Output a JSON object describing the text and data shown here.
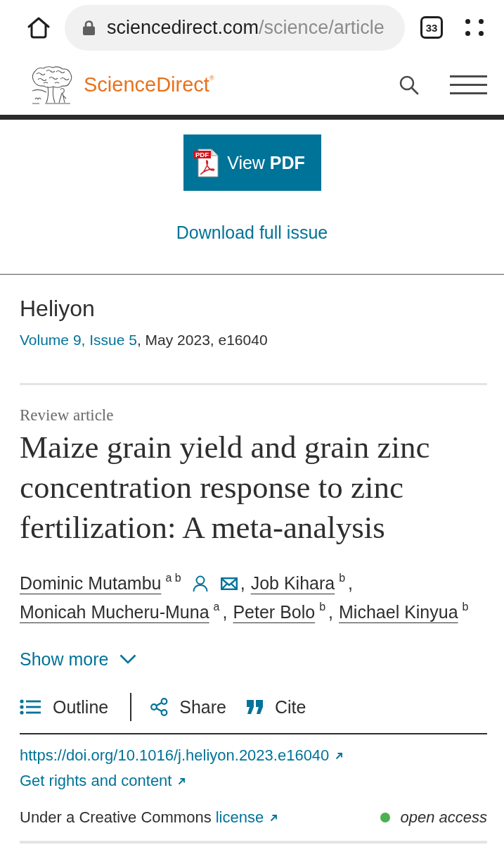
{
  "browser": {
    "url_host": "sciencedirect.com",
    "url_path": "/science/article",
    "tab_count": "33"
  },
  "header": {
    "brand": "ScienceDirect$^{®}$"
  },
  "pdf_button": {
    "label": "View **PDF**",
    "icon_text": "PDF"
  },
  "download_link": "Download full issue",
  "journal": {
    "name": "Heliyon",
    "issue_link": "Volume 9, Issue 5",
    "issue_rest": ", May 2023, e16040"
  },
  "article": {
    "type": "Review article",
    "title": "Maize grain yield and grain zinc concentration response to zinc fertilization: A meta-analysis"
  },
  "authors": [
    {
      "name": "Dominic Mutambu",
      "affiliations": "a b",
      "icons": [
        {
          "kind": "person"
        },
        {
          "kind": "email"
        }
      ],
      "separator": ","
    },
    {
      "name": "Job Kihara",
      "affiliations": "b",
      "separator": ","
    },
    {
      "name": "Monicah Mucheru-Muna",
      "affiliations": "a",
      "separator": ","
    },
    {
      "name": "Peter Bolo",
      "affiliations": "b",
      "separator": ","
    },
    {
      "name": "Michael Kinyua",
      "affiliations": "b"
    }
  ],
  "show_more": {
    "label": "Show more",
    "expanded": false
  },
  "toolbar": [
    {
      "kind": "outline",
      "label": "Outline"
    },
    {
      "kind": "share",
      "label": "Share"
    },
    {
      "kind": "cite",
      "label": "Cite"
    }
  ],
  "doi": {
    "label": "https://doi.org/10.1016/j.heliyon.2023.e16040",
    "external": true
  },
  "rights": {
    "label": "Get rights and content",
    "external": true
  },
  "license": {
    "text": "Under a Creative Commons ",
    "link": "license",
    "external": true
  },
  "access": {
    "label": "open access"
  }
}
